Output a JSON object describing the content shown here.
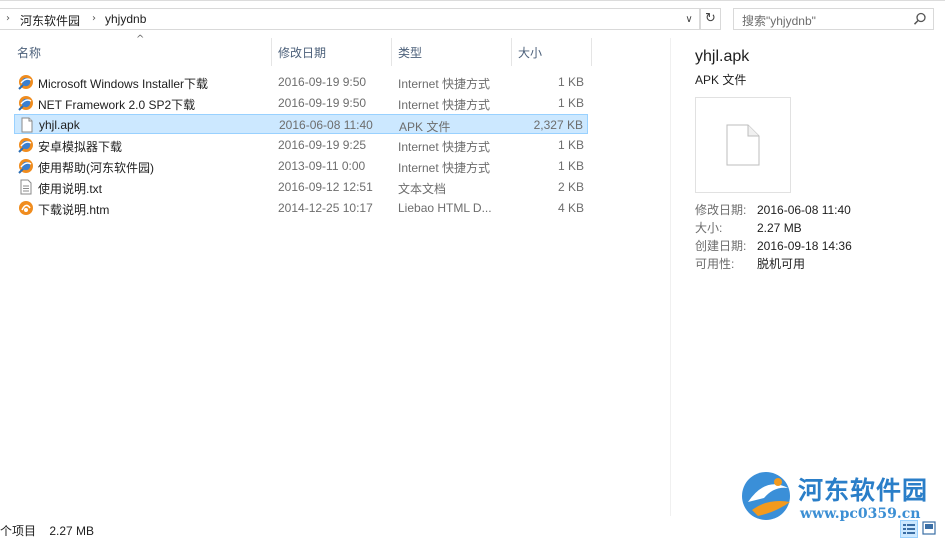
{
  "breadcrumb": {
    "items": [
      "河东软件园",
      "yhjydnb"
    ]
  },
  "search": {
    "placeholder": "搜索\"yhjydnb\""
  },
  "columns": {
    "name": "名称",
    "date": "修改日期",
    "type": "类型",
    "size": "大小"
  },
  "files": [
    {
      "name": "Microsoft Windows Installer下载",
      "date": "2016-09-19 9:50",
      "type": "Internet 快捷方式",
      "size": "1 KB",
      "icon": "internet-shortcut-icon",
      "selected": false
    },
    {
      "name": "NET Framework 2.0 SP2下载",
      "date": "2016-09-19 9:50",
      "type": "Internet 快捷方式",
      "size": "1 KB",
      "icon": "internet-shortcut-icon",
      "selected": false
    },
    {
      "name": "yhjl.apk",
      "date": "2016-06-08 11:40",
      "type": "APK 文件",
      "size": "2,327 KB",
      "icon": "file-icon",
      "selected": true
    },
    {
      "name": "安卓模拟器下载",
      "date": "2016-09-19 9:25",
      "type": "Internet 快捷方式",
      "size": "1 KB",
      "icon": "internet-shortcut-icon",
      "selected": false
    },
    {
      "name": "使用帮助(河东软件园)",
      "date": "2013-09-11 0:00",
      "type": "Internet 快捷方式",
      "size": "1 KB",
      "icon": "internet-shortcut-icon",
      "selected": false
    },
    {
      "name": "使用说明.txt",
      "date": "2016-09-12 12:51",
      "type": "文本文档",
      "size": "2 KB",
      "icon": "text-file-icon",
      "selected": false
    },
    {
      "name": "下载说明.htm",
      "date": "2014-12-25 10:17",
      "type": "Liebao HTML D...",
      "size": "4 KB",
      "icon": "html-file-icon",
      "selected": false
    }
  ],
  "details": {
    "title": "yhjl.apk",
    "type": "APK 文件",
    "props": [
      {
        "key": "修改日期:",
        "value": "2016-06-08 11:40"
      },
      {
        "key": "大小:",
        "value": "2.27 MB"
      },
      {
        "key": "创建日期:",
        "value": "2016-09-18 14:36"
      },
      {
        "key": "可用性:",
        "value": "脱机可用"
      }
    ]
  },
  "status": {
    "selection": "个项目",
    "size": "2.27 MB"
  },
  "watermark": {
    "site_name": "河东软件园",
    "url": "www.pc0359.cn"
  },
  "colors": {
    "selection_bg": "#cce8ff",
    "selection_border": "#99d1ff",
    "header_text": "#4c607a",
    "watermark": "#2a7ec8"
  }
}
